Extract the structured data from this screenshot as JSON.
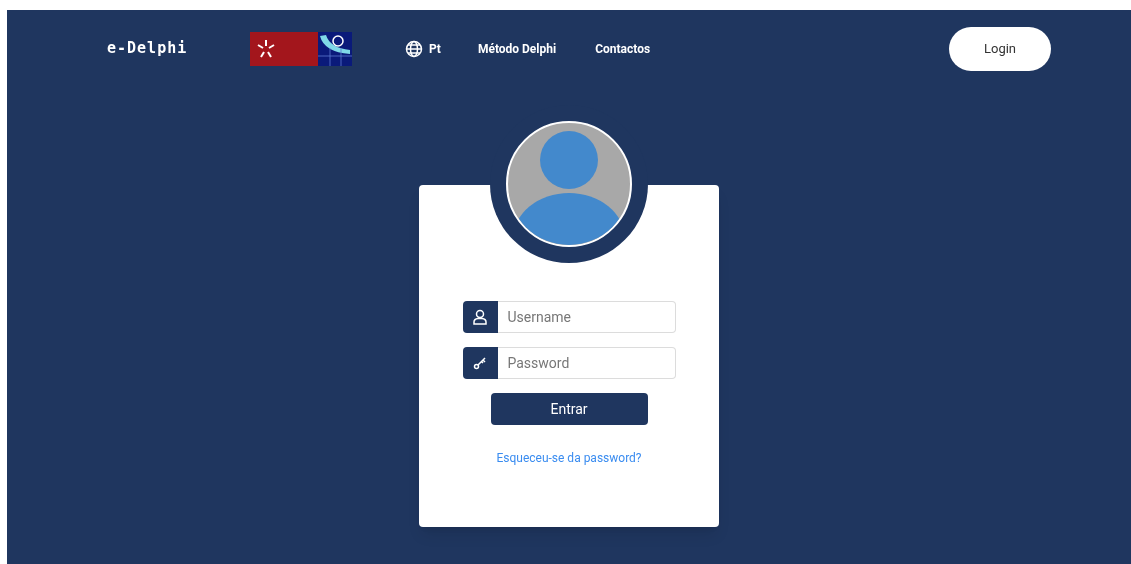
{
  "header": {
    "brand": "e-Delphi",
    "language": "Pt",
    "nav": [
      "Método Delphi",
      "Contactos"
    ],
    "login_button": "Login"
  },
  "login_form": {
    "fields": [
      {
        "kind": "user",
        "placeholder": "Username"
      },
      {
        "kind": "key",
        "placeholder": "Password"
      }
    ],
    "submit": "Entrar",
    "forgot_link": "Esqueceu-se da password?"
  }
}
